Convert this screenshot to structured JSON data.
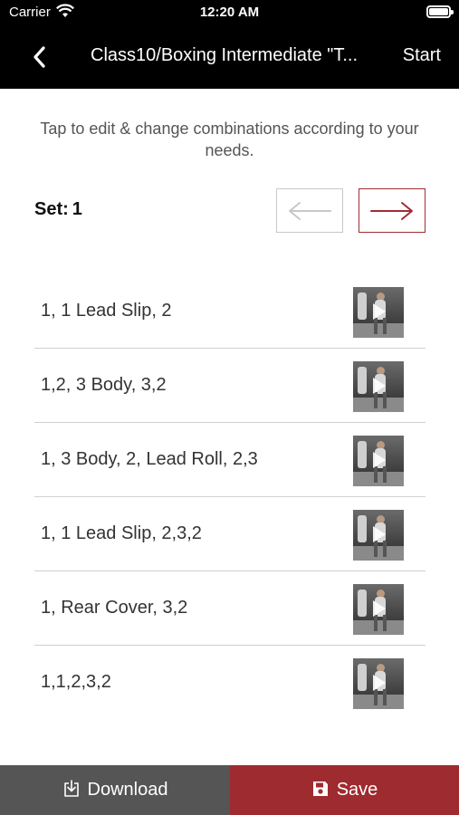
{
  "status_bar": {
    "carrier": "Carrier",
    "time": "12:20 AM",
    "icons": [
      "wifi-icon",
      "battery-icon"
    ]
  },
  "nav": {
    "back_icon": "chevron-left-icon",
    "title": "Class10/Boxing Intermediate \"T...",
    "start_label": "Start"
  },
  "instruction": "Tap to edit & change combinations according to your needs.",
  "set": {
    "label": "Set:",
    "number": "1",
    "prev_icon": "arrow-left-icon",
    "next_icon": "arrow-right-icon"
  },
  "combinations": [
    {
      "text": "1, 1 Lead Slip, 2",
      "thumb_icon": "video-thumbnail"
    },
    {
      "text": "1,2, 3 Body, 3,2",
      "thumb_icon": "video-thumbnail"
    },
    {
      "text": "1, 3 Body, 2, Lead Roll, 2,3",
      "thumb_icon": "video-thumbnail"
    },
    {
      "text": "1, 1 Lead Slip, 2,3,2",
      "thumb_icon": "video-thumbnail"
    },
    {
      "text": "1, Rear Cover, 3,2",
      "thumb_icon": "video-thumbnail"
    },
    {
      "text": "1,1,2,3,2",
      "thumb_icon": "video-thumbnail"
    }
  ],
  "footer": {
    "download_label": "Download",
    "download_icon": "download-icon",
    "save_label": "Save",
    "save_icon": "floppy-disk-icon"
  },
  "colors": {
    "header_bg": "#000000",
    "accent_red": "#9e2b2f",
    "download_bg": "#555555",
    "next_arrow": "#a12d33",
    "prev_arrow": "#c8c8c8"
  }
}
